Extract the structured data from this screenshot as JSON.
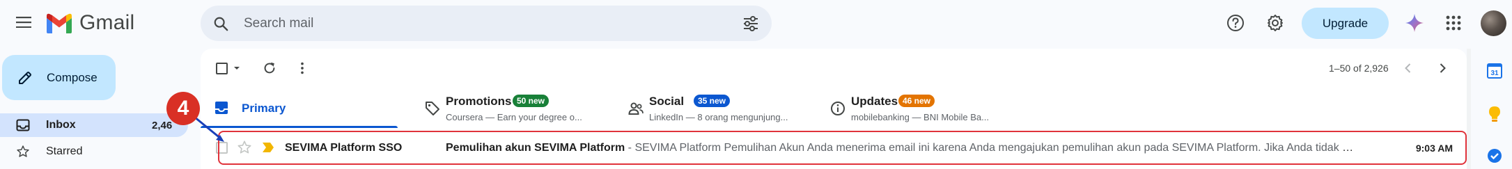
{
  "app": {
    "name": "Gmail"
  },
  "search": {
    "placeholder": "Search mail"
  },
  "header": {
    "upgrade_label": "Upgrade"
  },
  "compose": {
    "label": "Compose"
  },
  "sidebar": {
    "items": [
      {
        "label": "Inbox",
        "count": "2,46"
      },
      {
        "label": "Starred"
      }
    ]
  },
  "toolbar": {
    "pagination": "1–50 of 2,926"
  },
  "tabs": [
    {
      "label": "Primary"
    },
    {
      "label": "Promotions",
      "badge": "50 new",
      "badge_color": "#188038",
      "snippet": "Coursera — Earn your degree o..."
    },
    {
      "label": "Social",
      "badge": "35 new",
      "badge_color": "#0b57d0",
      "snippet": "LinkedIn — 8 orang mengunjung..."
    },
    {
      "label": "Updates",
      "badge": "46 new",
      "badge_color": "#e37400",
      "snippet": "mobilebanking — BNI Mobile Ba..."
    }
  ],
  "emails": [
    {
      "sender": "SEVIMA Platform SSO",
      "subject": "Pemulihan akun SEVIMA Platform",
      "separator": " - ",
      "snippet": "SEVIMA Platform Pemulihan Akun Anda menerima email ini karena Anda mengajukan pemulihan akun pada SEVIMA Platform. Jika Anda tidak me...",
      "time": "9:03 AM",
      "important": true
    }
  ],
  "annotation": {
    "step": "4",
    "color": "#d93025"
  },
  "colors": {
    "accent": "#0b57d0",
    "compose_bg": "#c2e7ff",
    "selected_nav": "#d3e3fd"
  },
  "right_panel": {
    "calendar_day": "31"
  }
}
